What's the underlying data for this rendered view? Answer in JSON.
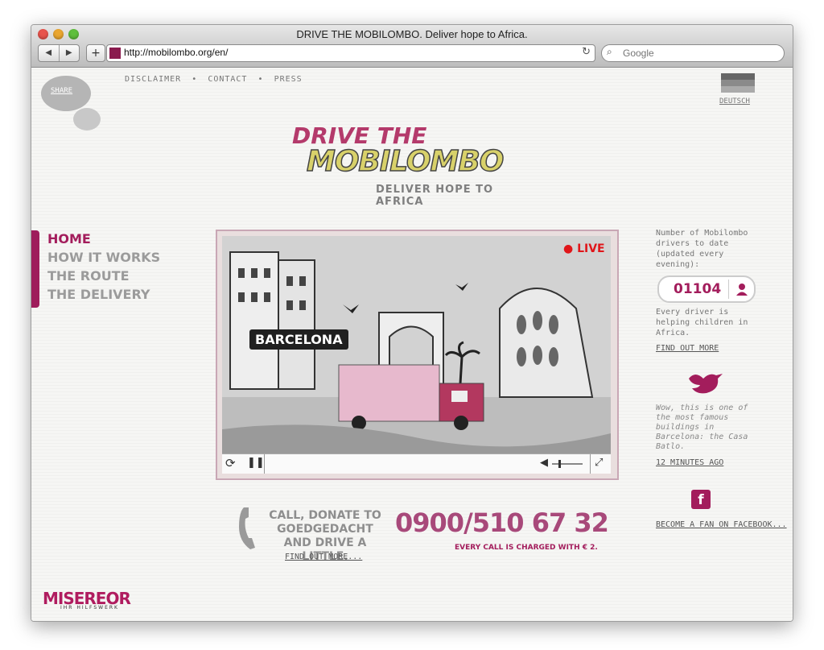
{
  "browser": {
    "title": "DRIVE THE MOBILOMBO. Deliver hope to Africa.",
    "url": "http://mobilombo.org/en/",
    "search_placeholder": "Google",
    "back_label": "◀",
    "forward_label": "▶",
    "add_label": "+",
    "reload_label": "↻"
  },
  "header": {
    "share": "SHARE",
    "nav": [
      "DISCLAIMER",
      "CONTACT",
      "PRESS"
    ],
    "separator": "•",
    "language": "DEUTSCH"
  },
  "logo": {
    "line1": "DRIVE THE",
    "line2": "MOBILOMBO",
    "tagline": "DELIVER HOPE TO AFRICA"
  },
  "menu": {
    "items": [
      "HOME",
      "HOW IT WORKS",
      "THE ROUTE",
      "THE DELIVERY"
    ],
    "active_index": 0
  },
  "video": {
    "live_label": "LIVE",
    "sign_label": "BARCELONA",
    "volume": 0.3
  },
  "sidebar": {
    "drivers_text": "Number of Mobilombo drivers to date (updated every evening):",
    "drivers_count": "01104",
    "helping_text": "Every driver is helping children in Africa.",
    "find_out_more": "FIND OUT MORE",
    "tweet": "Wow, this is one of the most famous buildings in Barcelona: the Casa Batlo.",
    "tweet_time": "12 MINUTES AGO",
    "fb_icon_label": "f",
    "facebook": "BECOME A FAN ON FACEBOOK..."
  },
  "call": {
    "text": "CALL, DONATE TO GOEDGEDACHT AND DRIVE A LITTLE.",
    "find_more": "FIND OUT MORE...",
    "number": "0900/510 67 32",
    "charge": "EVERY CALL IS CHARGED WITH € 2."
  },
  "footer": {
    "brand": "MISEREOR",
    "sub": "IHR HILFSWERK"
  },
  "colors": {
    "accent": "#a31d5c",
    "live": "#e0161a",
    "logo_yellow": "#d8d16a"
  }
}
